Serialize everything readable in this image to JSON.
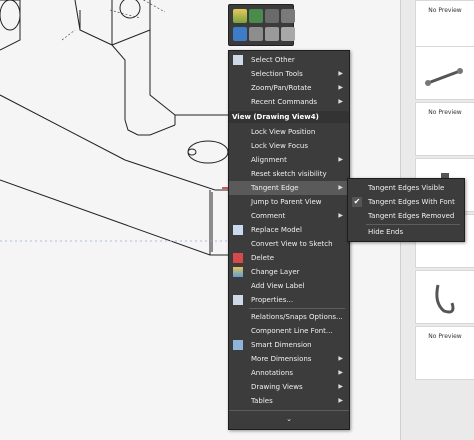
{
  "toolbar": {
    "icons": [
      "appearance-icon",
      "pin-icon",
      "edit-icon",
      "properties-icon",
      "cube-blue-icon",
      "cube-gray-icon",
      "display-style-icon",
      "hidden-lines-icon"
    ]
  },
  "menu": {
    "items_top": [
      {
        "label": "Select Other",
        "icon": "select-other-icon",
        "arrow": false
      },
      {
        "label": "Selection Tools",
        "icon": "",
        "arrow": true
      },
      {
        "label": "Zoom/Pan/Rotate",
        "icon": "",
        "arrow": true
      },
      {
        "label": "Recent Commands",
        "icon": "",
        "arrow": true
      }
    ],
    "section_header": "View (Drawing View4)",
    "items_view": [
      {
        "label": "Lock View Position",
        "arrow": false
      },
      {
        "label": "Lock View Focus",
        "arrow": false
      },
      {
        "label": "Alignment",
        "arrow": true
      },
      {
        "label": "Reset sketch visibility",
        "arrow": false
      },
      {
        "label": "Tangent Edge",
        "arrow": true
      },
      {
        "label": "Jump to Parent View",
        "arrow": false
      },
      {
        "label": "Comment",
        "arrow": true
      },
      {
        "label": "Replace Model",
        "arrow": false
      },
      {
        "label": "Convert View to Sketch",
        "arrow": false
      },
      {
        "label": "Delete",
        "arrow": false
      },
      {
        "label": "Change Layer",
        "arrow": false
      },
      {
        "label": "Add View Label",
        "arrow": false
      },
      {
        "label": "Properties...",
        "arrow": false
      }
    ],
    "items_bottom": [
      {
        "label": "Relations/Snaps Options...",
        "arrow": false
      },
      {
        "label": "Component Line Font...",
        "arrow": false
      },
      {
        "label": "Smart Dimension",
        "arrow": false
      },
      {
        "label": "More Dimensions",
        "arrow": true
      },
      {
        "label": "Annotations",
        "arrow": true
      },
      {
        "label": "Drawing Views",
        "arrow": true
      },
      {
        "label": "Tables",
        "arrow": true
      }
    ],
    "expand_glyph": "⌄"
  },
  "submenu": {
    "items": [
      {
        "label": "Tangent Edges Visible",
        "checked": false
      },
      {
        "label": "Tangent Edges With Font",
        "checked": true
      },
      {
        "label": "Tangent Edges Removed",
        "checked": false
      },
      {
        "label": "Hide Ends",
        "checked": false
      }
    ]
  },
  "palette": {
    "items": [
      {
        "label": "No Preview"
      },
      {
        "label": ""
      },
      {
        "label": "No Preview"
      },
      {
        "label": ""
      },
      {
        "label": "No Preview"
      },
      {
        "label": ""
      },
      {
        "label": "No Preview"
      }
    ]
  },
  "colors": {
    "menu_bg": "#3c3c3c",
    "annotation_red": "#cc2222",
    "canvas_bg": "#f5f5f5"
  }
}
